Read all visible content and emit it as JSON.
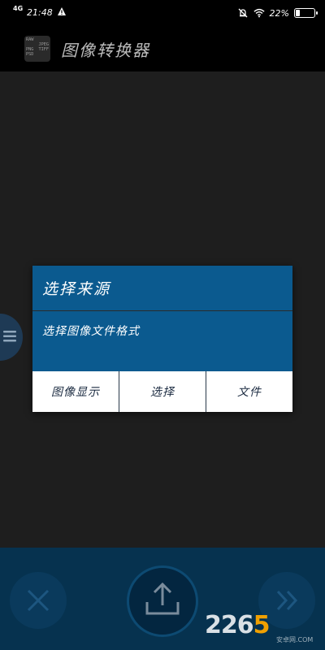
{
  "status_bar": {
    "network": "4G",
    "time": "21:48",
    "battery_percent": "22%",
    "battery_level": 0.22,
    "icons": [
      "alert-icon",
      "mute-icon",
      "wifi-icon",
      "battery-icon"
    ]
  },
  "app_bar": {
    "title": "图像转换器",
    "logo_lines": [
      [
        "RAW",
        ""
      ],
      [
        "",
        "JPEG"
      ],
      [
        "PNG",
        "TIFF"
      ],
      [
        "PSD",
        ""
      ]
    ]
  },
  "dialog": {
    "title": "选择来源",
    "message": "选择图像文件格式",
    "buttons": [
      "图像显示",
      "选择",
      "文件"
    ]
  },
  "bottom_bar": {
    "icons": [
      "close-icon",
      "upload-icon",
      "fast-forward-icon"
    ]
  },
  "watermark": {
    "text_main": "226",
    "text_accent": "5",
    "text_sub": "安卓网.COM"
  },
  "colors": {
    "dialog_bg": "#0b5a8f",
    "bottom_bar_bg": "#06324f",
    "screen_bg": "#1e1e1e"
  }
}
